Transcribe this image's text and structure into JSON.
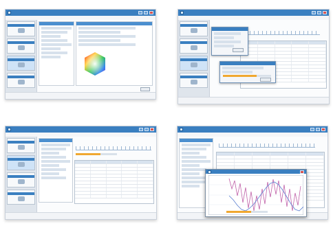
{
  "screens": [
    {
      "id": "topleft",
      "statusbar": "",
      "menu": [
        "",
        "",
        ""
      ]
    },
    {
      "id": "topright",
      "statusbar": "",
      "menu": [
        "",
        "",
        ""
      ]
    },
    {
      "id": "bottomleft",
      "statusbar": "",
      "menu": [
        "",
        "",
        ""
      ]
    },
    {
      "id": "bottomright",
      "statusbar": "",
      "menu": [
        "",
        "",
        ""
      ]
    }
  ],
  "icons": {
    "app": "app-icon",
    "minimize": "minimize-icon",
    "maximize": "maximize-icon",
    "close": "close-icon",
    "color_wheel": "color-hexagon-icon"
  },
  "colors": {
    "title_bar": "#3a7fc0",
    "nav_bg": "#dfe5ec",
    "progress": "#f0a830",
    "chart_series_1": "#c060a8",
    "chart_series_2": "#5b7fd1"
  },
  "chart_window": {
    "progress_value": 0.6
  }
}
